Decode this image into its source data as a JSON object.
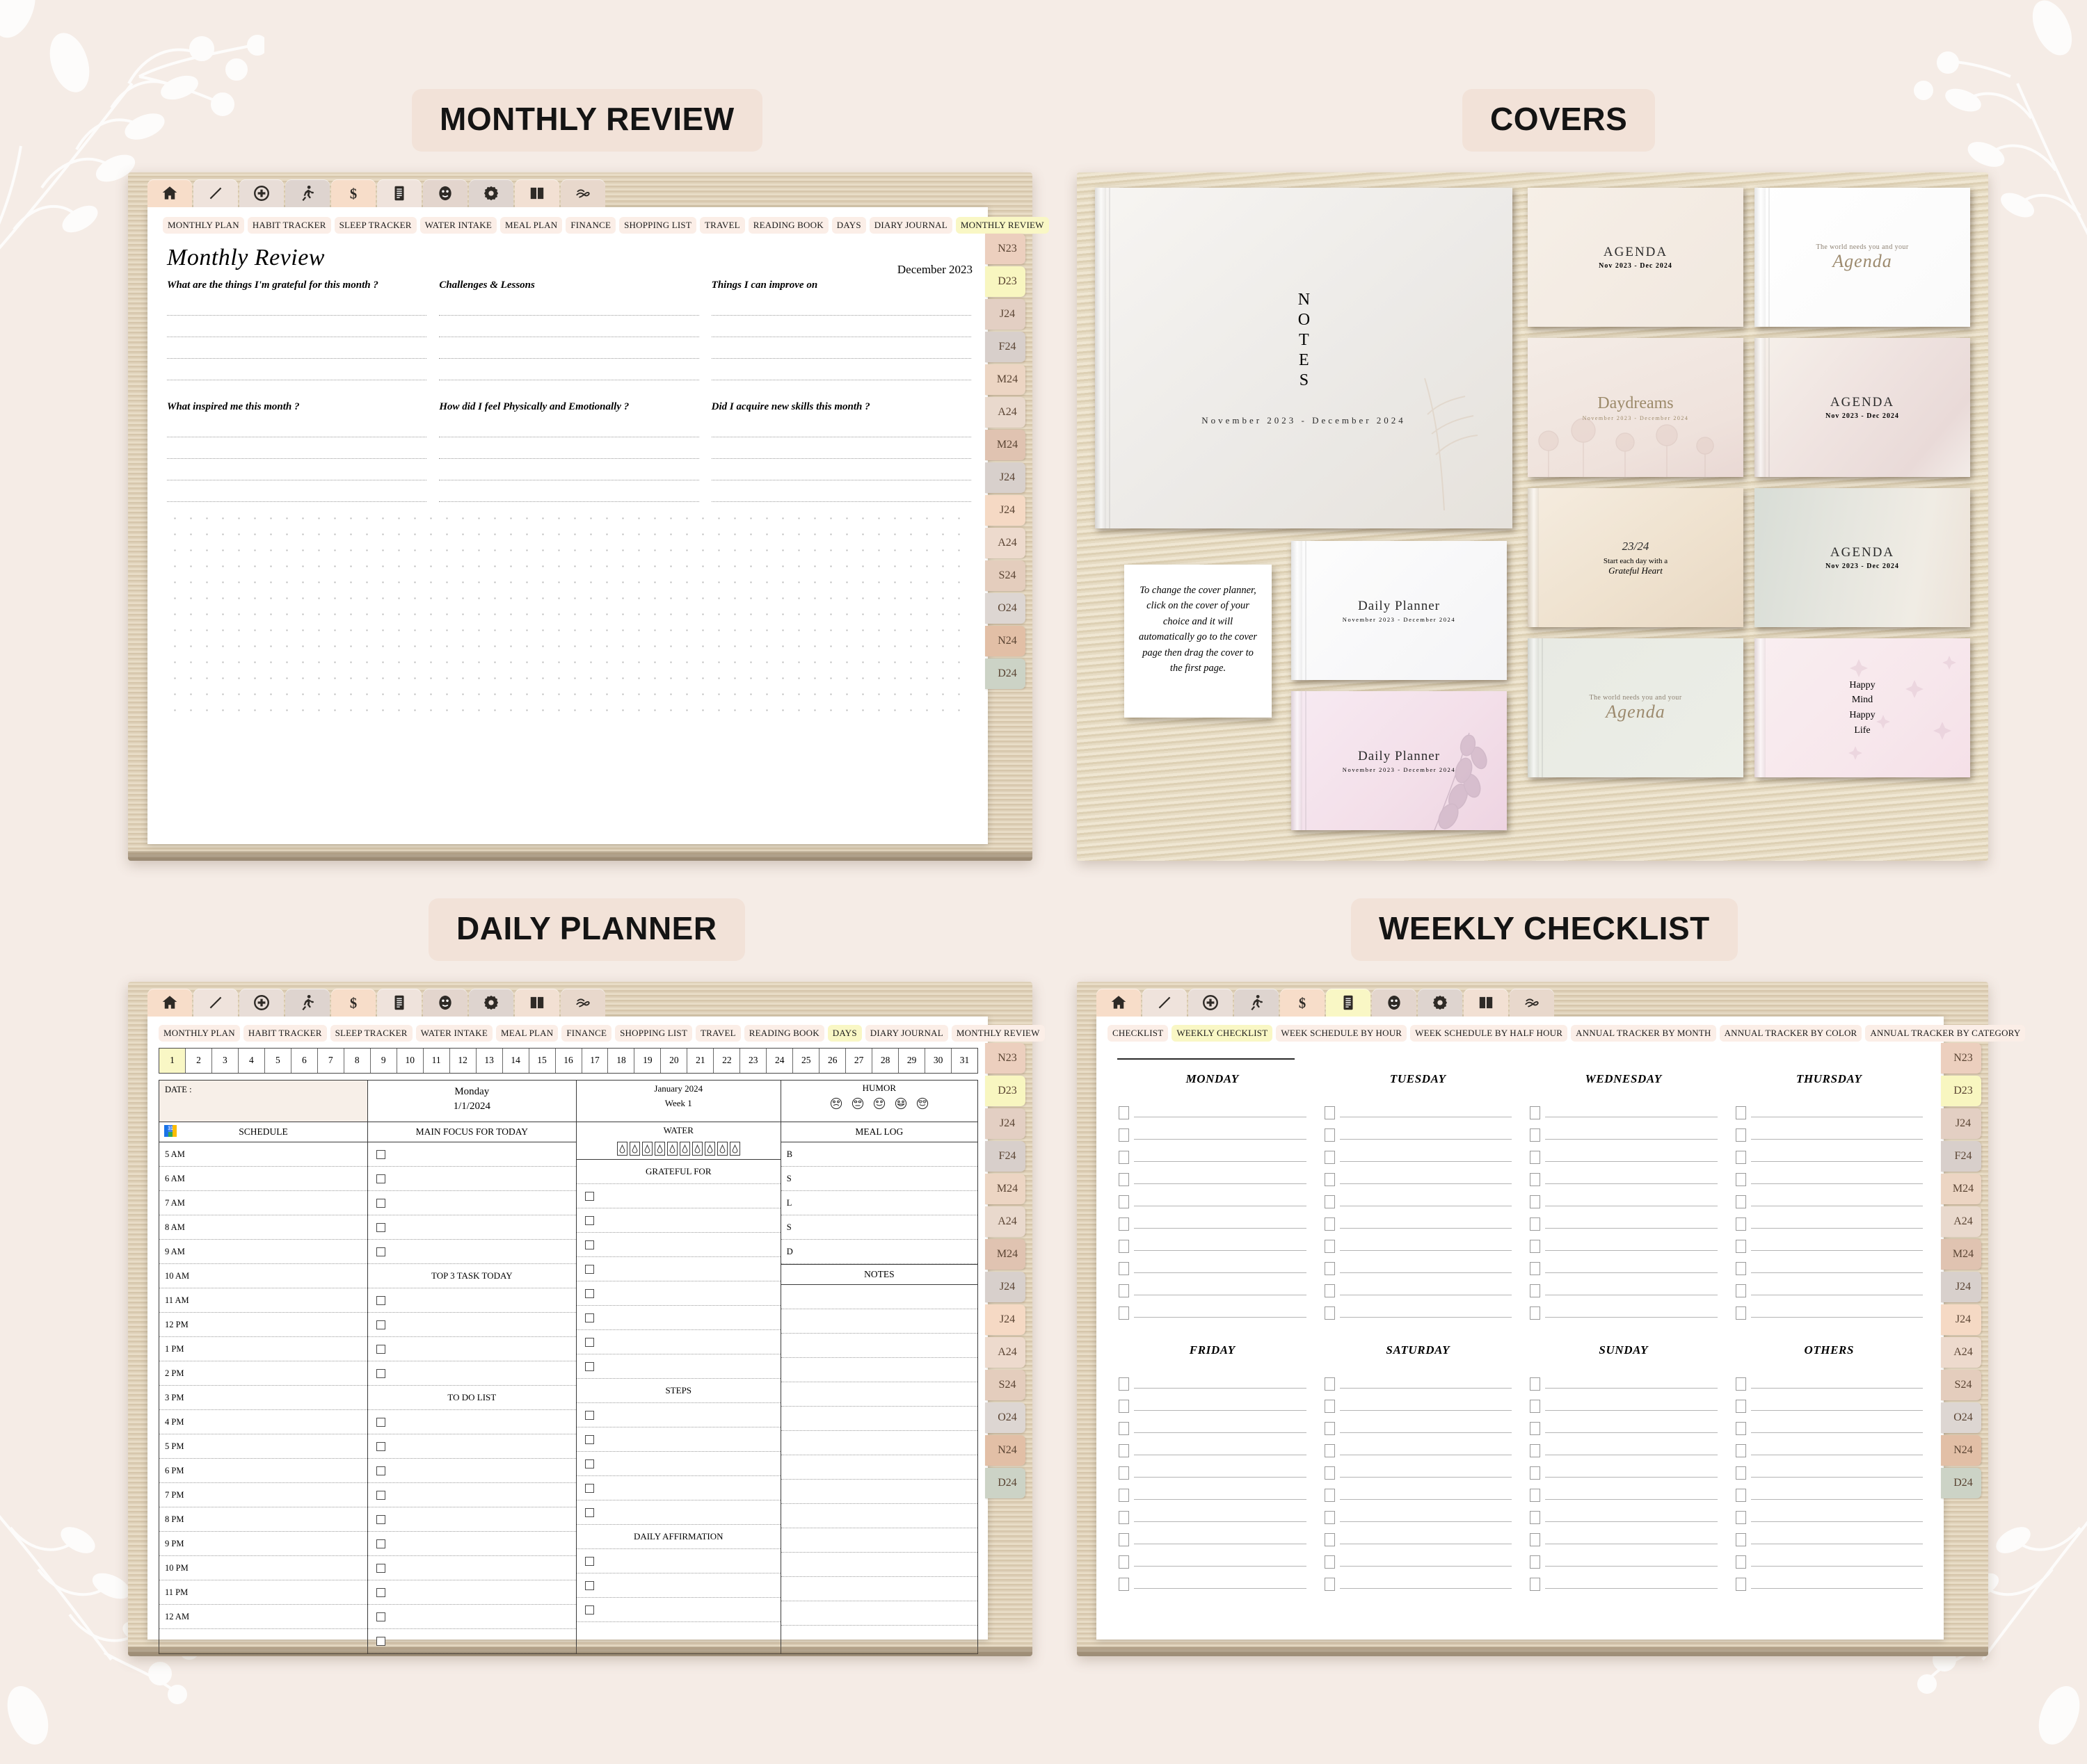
{
  "sections": {
    "monthly_review": "MONTHLY REVIEW",
    "covers": "COVERS",
    "daily_planner": "DAILY PLANNER",
    "weekly_checklist": "WEEKLY CHECKLIST"
  },
  "toolbar_icons": [
    {
      "name": "home-icon",
      "glyph": "home",
      "bg": "#f7ddc9"
    },
    {
      "name": "pen-icon",
      "glyph": "pen",
      "bg": "#efe3dc"
    },
    {
      "name": "medical-plus-icon",
      "glyph": "plus",
      "bg": "#e8ddd7"
    },
    {
      "name": "running-person-icon",
      "glyph": "run",
      "bg": "#ded4cf"
    },
    {
      "name": "dollar-icon",
      "glyph": "dollar",
      "bg": "#f7ddc9"
    },
    {
      "name": "document-icon",
      "glyph": "doc",
      "bg": "#efe3dc"
    },
    {
      "name": "smiley-icon",
      "glyph": "smile",
      "bg": "#e3d5cd"
    },
    {
      "name": "gear-icon",
      "glyph": "gear",
      "bg": "#ded4cf"
    },
    {
      "name": "book-icon",
      "glyph": "book",
      "bg": "#f2e0d3"
    },
    {
      "name": "link-icon",
      "glyph": "link",
      "bg": "#e8d8cc"
    }
  ],
  "month_tabs": [
    {
      "label": "N23",
      "color": "#eccfbe"
    },
    {
      "label": "D23",
      "color": "#f8f6c0"
    },
    {
      "label": "J24",
      "color": "#e3cfc3"
    },
    {
      "label": "F24",
      "color": "#d8cfcb"
    },
    {
      "label": "M24",
      "color": "#ecd5c3"
    },
    {
      "label": "A24",
      "color": "#e9d9cd"
    },
    {
      "label": "M24",
      "color": "#e0c3b1"
    },
    {
      "label": "J24",
      "color": "#d8d0cc"
    },
    {
      "label": "J24",
      "color": "#f5d9c4"
    },
    {
      "label": "A24",
      "color": "#eddacd"
    },
    {
      "label": "S24",
      "color": "#e4cdbd"
    },
    {
      "label": "O24",
      "color": "#ddd6d2"
    },
    {
      "label": "N24",
      "color": "#e2bfa6"
    },
    {
      "label": "D24",
      "color": "#ccd3c6"
    }
  ],
  "monthly_review": {
    "nav": [
      "MONTHLY PLAN",
      "HABIT TRACKER",
      "SLEEP TRACKER",
      "WATER INTAKE",
      "MEAL PLAN",
      "FINANCE",
      "SHOPPING LIST",
      "TRAVEL",
      "READING BOOK",
      "DAYS",
      "DIARY JOURNAL",
      "MONTHLY REVIEW"
    ],
    "active_nav": "MONTHLY REVIEW",
    "title": "Monthly Review",
    "date": "December 2023",
    "questions_row1": [
      "What are the things I'm grateful for this month ?",
      "Challenges & Lessons",
      "Things I can improve on"
    ],
    "questions_row2": [
      "What inspired me this month ?",
      "How did I feel Physically and Emotionally ?",
      "Did I acquire new skills this month ?"
    ]
  },
  "covers": {
    "instruction": "To change the cover planner, click on the cover of your choice and it will automatically go to the cover page then drag the cover to the first page.",
    "main": {
      "title": "NOTES",
      "subtitle": "November 2023 - December 2024"
    },
    "grid": [
      {
        "title": "AGENDA",
        "subtitle": "Nov 2023 - Dec 2024",
        "style": "plain-cream"
      },
      {
        "title": "Agenda",
        "subtitle": "The world needs you and your",
        "style": "script-white"
      },
      {
        "title": "Daydreams",
        "subtitle": "November 2023 - December 2024",
        "style": "daydreams"
      },
      {
        "title": "AGENDA",
        "subtitle": "Nov 2023 - Dec 2024",
        "style": "blush-wash"
      },
      {
        "title": "Daily Planner",
        "subtitle": "November 2023 - December 2024",
        "style": "plain-white"
      },
      {
        "title": "23/24",
        "subtitle": "Start each day with a",
        "subtitle2": "Grateful Heart",
        "style": "sand"
      },
      {
        "title": "AGENDA",
        "subtitle": "Nov 2023 - Dec 2024",
        "style": "sage-wash"
      },
      {
        "title": "Daily Planner",
        "subtitle": "November 2023 - December 2024",
        "style": "pink-floral"
      },
      {
        "title": "Agenda",
        "subtitle": "The world needs you and your",
        "style": "script-sage"
      },
      {
        "title": "Happy Mind Happy Life",
        "subtitle": "",
        "style": "pink-stars",
        "lines": [
          "Happy",
          "Mind",
          "Happy",
          "Life"
        ]
      }
    ]
  },
  "daily_planner": {
    "nav": [
      "MONTHLY PLAN",
      "HABIT TRACKER",
      "SLEEP TRACKER",
      "WATER INTAKE",
      "MEAL PLAN",
      "FINANCE",
      "SHOPPING LIST",
      "TRAVEL",
      "READING BOOK",
      "DAYS",
      "DIARY JOURNAL",
      "MONTHLY REVIEW"
    ],
    "active_nav": "DAYS",
    "days": [
      "1",
      "2",
      "3",
      "4",
      "5",
      "6",
      "7",
      "8",
      "9",
      "10",
      "11",
      "12",
      "13",
      "14",
      "15",
      "16",
      "17",
      "18",
      "19",
      "20",
      "21",
      "22",
      "23",
      "24",
      "25",
      "26",
      "27",
      "28",
      "29",
      "30",
      "31"
    ],
    "active_day": "1",
    "date_label": "DATE :",
    "day_name": "Monday",
    "day_date": "1/1/2024",
    "month_label": "January 2024",
    "week_label": "Week 1",
    "humor_header": "HUMOR",
    "meal_log_header": "MEAL LOG",
    "meal_rows": [
      "B",
      "S",
      "L",
      "S",
      "D"
    ],
    "notes_header": "NOTES",
    "schedule_header": "SCHEDULE",
    "main_focus_header": "MAIN FOCUS FOR TODAY",
    "top3_header": "TOP 3 TASK TODAY",
    "todo_header": "TO DO LIST",
    "water_header": "WATER",
    "water_glass_count": 10,
    "grateful_header": "GRATEFUL FOR",
    "steps_header": "STEPS",
    "affirmation_header": "DAILY AFFIRMATION",
    "hours": [
      "5 AM",
      "6 AM",
      "7 AM",
      "8 AM",
      "9 AM",
      "10 AM",
      "11 AM",
      "12 PM",
      "1 PM",
      "2 PM",
      "3 PM",
      "4 PM",
      "5 PM",
      "6 PM",
      "7 PM",
      "8 PM",
      "9 PM",
      "10 PM",
      "11 PM",
      "12 AM"
    ]
  },
  "weekly_checklist": {
    "nav": [
      "CHECKLIST",
      "WEEKLY CHECKLIST",
      "WEEK SCHEDULE BY HOUR",
      "WEEK SCHEDULE BY HALF HOUR",
      "ANNUAL TRACKER BY MONTH",
      "ANNUAL TRACKER BY COLOR",
      "ANNUAL TRACKER BY CATEGORY"
    ],
    "active_nav": "WEEKLY CHECKLIST",
    "row1": [
      "MONDAY",
      "TUESDAY",
      "WEDNESDAY",
      "THURSDAY"
    ],
    "row2": [
      "FRIDAY",
      "SATURDAY",
      "SUNDAY",
      "OTHERS"
    ],
    "rows_per_column": 10
  },
  "colors": {
    "background": "#f5ece6",
    "badge": "#f2e2d8",
    "chip": "#fbeee7",
    "chip_active": "#f9f7c5"
  }
}
